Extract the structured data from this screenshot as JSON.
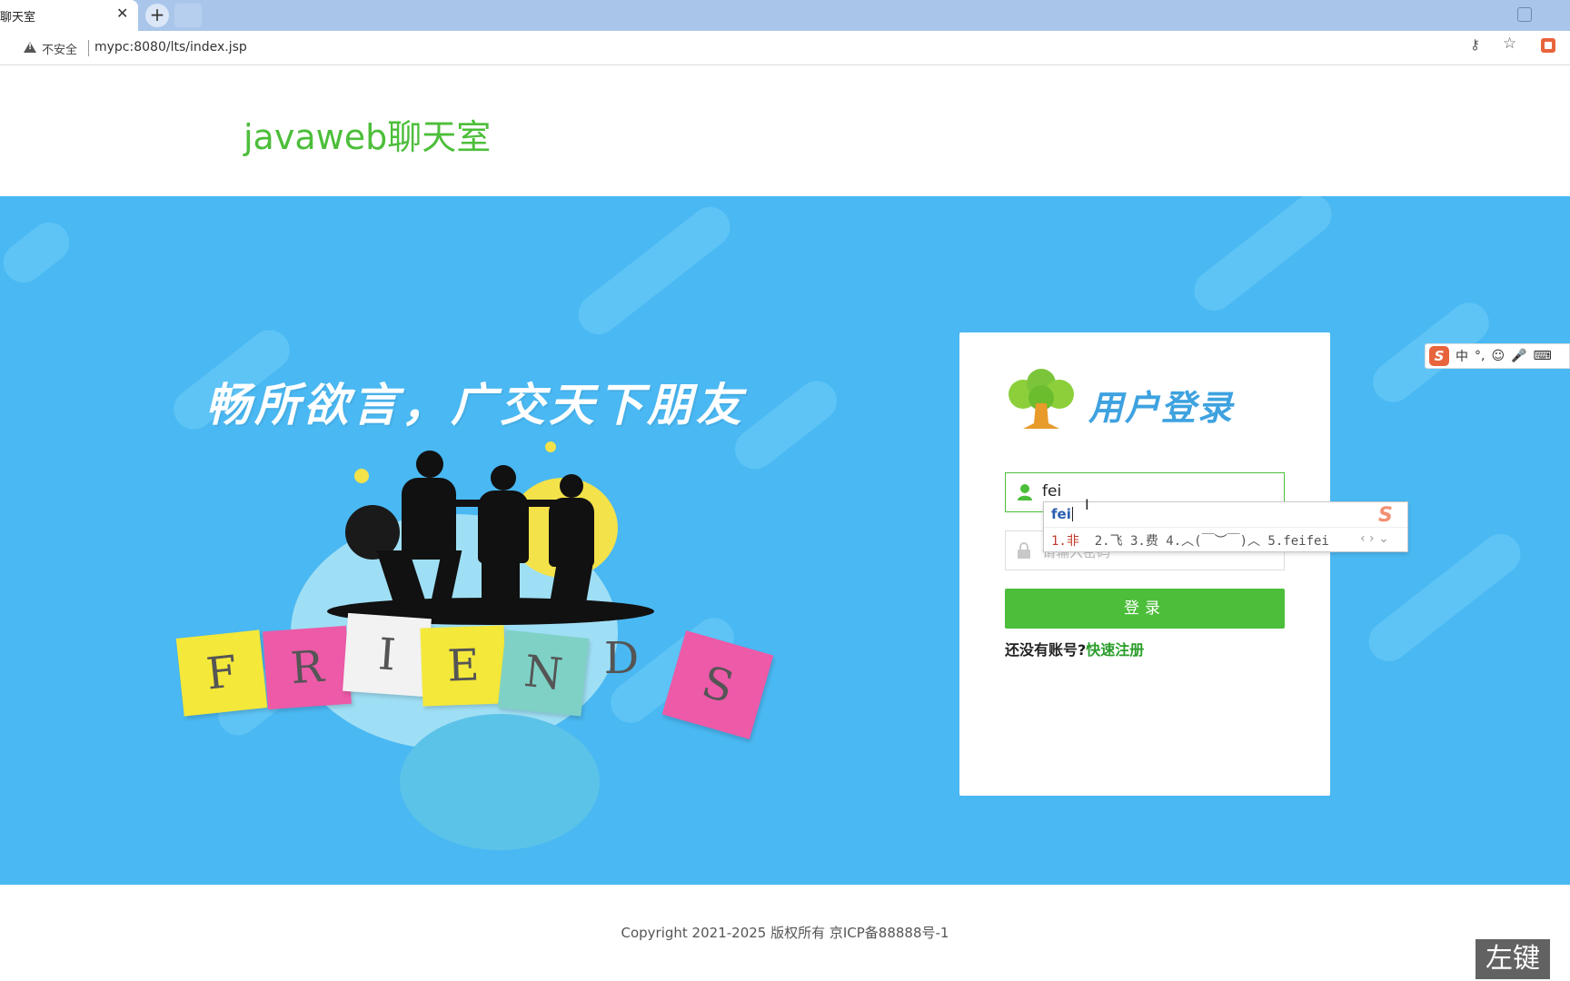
{
  "browser": {
    "tab_title": "聊天室",
    "tab_close": "✕",
    "new_tab": "+",
    "security_label": "不安全",
    "url": "mypc:8080/lts/index.jsp"
  },
  "header": {
    "title": "javaweb聊天室"
  },
  "banner": {
    "slogan": "畅所欲言，广交天下朋友",
    "friends_letters": [
      "F",
      "R",
      "I",
      "E",
      "N",
      "D",
      "S"
    ]
  },
  "login": {
    "title": "用户登录",
    "username_value": "fei",
    "password_placeholder": "请输入密码",
    "submit_label": "登录",
    "register_prompt": "还没有账号?",
    "register_link": "快速注册"
  },
  "ime": {
    "composition": "fei",
    "first_candidate": "1.非",
    "candidates": "2.飞  3.费  4.︿(￣︶￣)︿  5.feifei",
    "nav": "‹ › ⌄",
    "toolbar": [
      "中",
      "°,",
      "☺",
      "🎤",
      "⌨"
    ]
  },
  "footer": {
    "copyright": "Copyright 2021-2025 版权所有 京ICP备88888号-1"
  },
  "overlay": {
    "mouse_hint": "左键"
  },
  "colors": {
    "brand_green": "#4cbe3a",
    "banner_blue": "#4ab8f2",
    "title_blue": "#3ea2e0"
  }
}
